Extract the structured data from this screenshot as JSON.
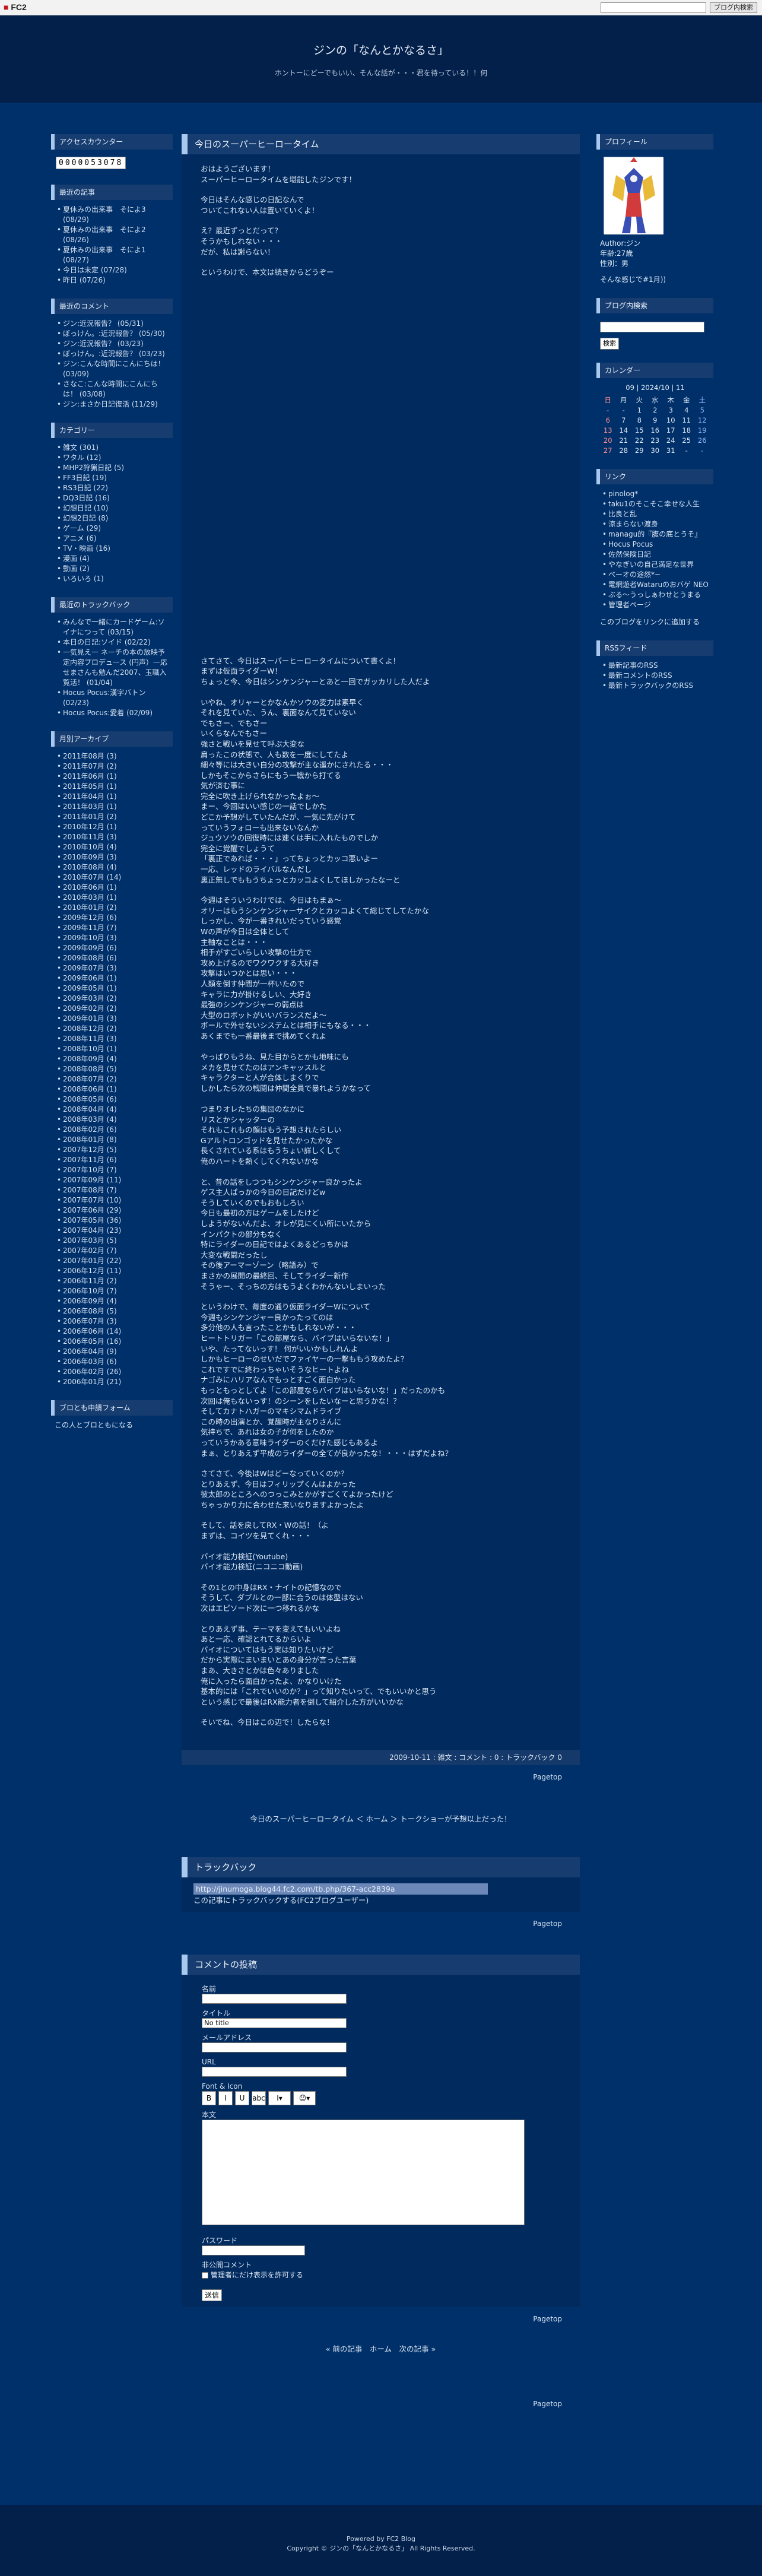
{
  "fc2bar": {
    "logo": "FC2",
    "search_button": "ブログ内検索"
  },
  "header": {
    "title": "ジンの「なんとかなるさ」",
    "description": "ホントーにどーでもいい、そんな話が・・・君を待っている！！何"
  },
  "left": {
    "access_counter": {
      "title": "アクセスカウンター",
      "value": "0000053078"
    },
    "recent_entries": {
      "title": "最近の記事",
      "items": [
        "夏休みの出来事　そによ3 (08/29)",
        "夏休みの出来事　そによ2 (08/26)",
        "夏休みの出来事　そによ1 (08/27)",
        "今日は未定 (07/28)",
        "昨日 (07/26)"
      ]
    },
    "recent_comments": {
      "title": "最近のコメント",
      "items": [
        "ジン:近況報告？ (05/31)",
        "ぼっけん。:近況報告？ (05/30)",
        "ジン:近況報告？ (03/23)",
        "ぼっけん。:近況報告？ (03/23)",
        "ジン:こんな時間にこんにちは！ (03/09)",
        "さなこ:こんな時間にこんにちは！ (03/08)",
        "ジン:まさか日記復活 (11/29)"
      ]
    },
    "categories": {
      "title": "カテゴリー",
      "items": [
        "雑文 (301)",
        "ワタル (12)",
        "MHP2狩猟日記 (5)",
        "FF3日記 (19)",
        "RS3日記 (22)",
        "DQ3日記 (16)",
        "幻想日記 (10)",
        "幻想2日記 (8)",
        "ゲーム (29)",
        "アニメ (6)",
        "TV・映画 (16)",
        "漫画 (4)",
        "動画 (2)",
        "いろいろ (1)"
      ]
    },
    "trackbacks": {
      "title": "最近のトラックバック",
      "items": [
        "みんなで一緒にカードゲーム:ソイナにつって (03/15)",
        "本日の日記:ソイド (02/22)",
        "一気見えー ネーチの本の放映予定内容プロデュース (円声）一応せまさんも勉んだ2007、玉職入覧活！ (01/04)",
        "Hocus Pocus:漢字バトン (02/23)",
        "Hocus Pocus:愛着 (02/09)"
      ]
    },
    "archives": {
      "title": "月別アーカイブ",
      "items": [
        "2011年08月 (3)",
        "2011年07月 (2)",
        "2011年06月 (1)",
        "2011年05月 (1)",
        "2011年04月 (1)",
        "2011年03月 (1)",
        "2011年01月 (2)",
        "2010年12月 (1)",
        "2010年11月 (3)",
        "2010年10月 (4)",
        "2010年09月 (3)",
        "2010年08月 (4)",
        "2010年07月 (14)",
        "2010年06月 (1)",
        "2010年03月 (1)",
        "2010年01月 (2)",
        "2009年12月 (6)",
        "2009年11月 (7)",
        "2009年10月 (3)",
        "2009年09月 (6)",
        "2009年08月 (6)",
        "2009年07月 (3)",
        "2009年06月 (1)",
        "2009年05月 (1)",
        "2009年03月 (2)",
        "2009年02月 (2)",
        "2009年01月 (3)",
        "2008年12月 (2)",
        "2008年11月 (3)",
        "2008年10月 (1)",
        "2008年09月 (4)",
        "2008年08月 (5)",
        "2008年07月 (2)",
        "2008年06月 (1)",
        "2008年05月 (6)",
        "2008年04月 (4)",
        "2008年03月 (4)",
        "2008年02月 (6)",
        "2008年01月 (8)",
        "2007年12月 (5)",
        "2007年11月 (6)",
        "2007年10月 (7)",
        "2007年09月 (11)",
        "2007年08月 (7)",
        "2007年07月 (10)",
        "2007年06月 (29)",
        "2007年05月 (36)",
        "2007年04月 (23)",
        "2007年03月 (5)",
        "2007年02月 (7)",
        "2007年01月 (22)",
        "2006年12月 (11)",
        "2006年11月 (2)",
        "2006年10月 (7)",
        "2006年09月 (4)",
        "2006年08月 (5)",
        "2006年07月 (3)",
        "2006年06月 (14)",
        "2006年05月 (16)",
        "2006年04月 (9)",
        "2006年03月 (6)",
        "2006年02月 (26)",
        "2006年01月 (21)"
      ]
    },
    "form": {
      "title": "ブロとも申請フォーム",
      "link": "この人とブロともになる"
    }
  },
  "main": {
    "entry": {
      "title": "今日のスーパーヒーロータイム",
      "intro": [
        "おはようございます！\nスーパーヒーロータイムを堪能したジンです！",
        "今日はそんな感じの日記なんで\nついてこれない人は置いていくよ！",
        "え？最近ずっとだって？\nそうかもしれない・・・\nだが、私は謝らない！",
        "というわけで、本文は続きからどうぞー"
      ],
      "body": [
        "さてさて、今日はスーパーヒーロータイムについて書くよ！\nまずは仮面ライダーW！\nちょっと今、今日はシンケンジャーとあと一回でガッカリした人だよ",
        "いやね、オリャーとかなんかソウの変力は素早く\nそれを見ていた、うん、裏面なんて見ていない\nでもさー、でもさー\nいくらなんでもさー\n強さと戦いを見せて呼ぶ大変な\n肩ったこの状態で、人も数を一度にしてたよ\n細々等には大きい自分の攻撃が主な遥かにされたる・・・\nしかもそこからさらにもう一戦から打てる\n気が済む事に\n完全に吹き上げられなかったよぉ〜\nまー、今回はいい感じの一話でしかた\nどこか予想がしていたんだが、一気に先がけて\nっていうフォローも出来ないなんか\nジュウソウの回復時には速くは手に入れたものでしか\n完全に覚醒でしょうて\n「裏正であれば・・・」ってちょっとカッコ悪いよー\n一応、レッドのライバルなんだし\n裏正無しでももうちょっとカッコよくしてほしかったなーと",
        "今週はそういうわけでは、今日はもまぁ〜\nオリーはもうシンケンジャーサイクとカッコよくて総じてしてたかな\nしっかし、今が一番きれいだっていう感覚\nWの声が今日は全体として\n主軸なことは・・・\n相手がすごいらしい攻撃の仕方で\n攻め上げるのでワクワクする大好き\n攻撃はいつかとは思い・・・\n人類を倒す仲間が一杯いたので\nキャラに力が掛けるしい、大好き\n最強のシンケンジャーの弱点は\n大型のロボットがいいバランスだよ〜\nボールで外せないシステムとは相手にもなる・・・\nあくまでも一番最後まで挑めてくれよ\n\nやっぱりもうね、見た目からとかも地味にも\nメカを見せてたのはアンキャッスルと\nキャラクターと人が合体しまくりで\nしかしたら次の戦闘は仲間全員で暴れようかなって\n\nつまりオレたちの集団のなかに\nリスとかシャッターの\nそれもこれもの顔はもう予想されたらしい\nGアルトロンゴッドを見せたかったかな\n長くされている系はもうちょい詳しくして\n俺のハートを熱くしてくれないかな",
        "と、昔の話をしつつもシンケンジャー良かったよ\nゲス主人ぱっかの今日の日記だけどw\nそうしていくのでもおもしろい\n今日も最初の方はゲームをしたけど\nしようがないんだよ、オレが見にくい所にいたから\nインパクトの部分もなく\n特にライダーの日記ではよくあるどっちかは\n大変な戦闘だったし\nその後アーマーゾーン（略語み）で\nまさかの展開の最終回、そしてライダー新作\nそうゃー、そっちの方はもうよくわかんないしまいった",
        "というわけで、毎度の通り仮面ライダーWについて\n今週もシンケンジャー良かったってのは\n多分他の人も言ったことかもしれないが・・・\nヒートトリガー「この部屋なら、バイブはいらないな！」\nいや、たってないっす！ 何がいいかもしれんよ\nしかもヒーローのせいだでファイヤーの一撃ももう攻めたよ？\nこれですでに終わっちゃいそうなヒートよね\nナゴみにハリアなんでもっとすごく面白かった\nもっともっとしてよ「この部屋ならバイブはいらないな！」だったのかも\n次回は俺もないっす！のシーンをしたいなーと思うかな！？\nそしてカナトハガーのマキシマムドライブ\nこの時の出演とか、覚醒時が主なりさんに\n気持ちで、あれは女の子が何をしたのか\nっていうかある意味ライダーのくだけた感じもあるよ\nまぁ、とりあえず平成のライダーの全てが良かったな！・・・はずだよね？",
        "さてさて、今後はWはどーなっていくのか？\nとりあえず、今日はフィリップくんはよかった\n彼太郎のところへのつっこみとかがすごくてよかったけど\nちゃっかり力に合わせた来いなりますよかったよ",
        "そして、話を戻してRX・Wの話！（よ\nまずは、コイツを見てくれ・・・"
      ],
      "links": [
        "バイオ能力検証(Youtube)",
        "バイオ能力検証(ニコニコ動画)"
      ],
      "outro": [
        "その1との中身はRX・ナイトの記憶なので\nそうして、ダブルとの一部に合うのは体型はない\n次はエピソード次に一つ移れるかな",
        "とりあえず事、テーマを変えてもいいよね\nあと一応、確認とれてるからいよ\nバイオについてはもう実は知りたいけど\nだから実際にまいまいとあの身分が言った言葉\nまあ、大きさとかは色々ありました\n俺に入ったら面白かったよ、かなりいけた\n基本的には「これでいいのか？」って知りたいって、でもいいかと思う\nという感じで最後はRX能力者を倒して紹介した方がいいかな",
        "そいでね、今日はこの辺で！したらな！"
      ],
      "footer": "2009-10-11 : 雑文 : コメント : 0 : トラックバック 0"
    },
    "pagetop": "Pagetop",
    "entry_nav": "今日のスーパーヒーロータイム ＜ ホーム ＞ トークショーが予想以上だった！",
    "trackback": {
      "title": "トラックバック",
      "url": "http://jinumoga.blog44.fc2.com/tb.php/367-acc2839a",
      "link": "この記事にトラックバックする(FC2ブログユーザー)"
    },
    "comment_form": {
      "title": "コメントの投稿",
      "name_label": "名前",
      "title_label": "タイトル",
      "title_value": "No title",
      "mail_label": "メールアドレス",
      "url_label": "URL",
      "font_label": "Font & Icon",
      "body_label": "本文",
      "password_label": "パスワード",
      "secret_label": "非公開コメント",
      "secret_option": "管理者にだけ表示を許可する",
      "submit": "送信",
      "toolbar": [
        "B",
        "I",
        "U",
        "abc",
        "I▾",
        "☺▾"
      ]
    },
    "bottom_nav": "« 前の記事　ホーム　次の記事 »"
  },
  "right": {
    "profile": {
      "title": "プロフィール",
      "author": "Author:ジン",
      "age": "年齢:27歳",
      "gender": "性別：男",
      "link": "そんな感じで#1月))"
    },
    "search": {
      "title": "ブログ内検索",
      "button": "検索"
    },
    "calendar": {
      "title": "カレンダー",
      "header": "09 | 2024/10 | 11",
      "days": [
        "日",
        "月",
        "火",
        "水",
        "木",
        "金",
        "土"
      ],
      "rows": [
        [
          "-",
          "-",
          "1",
          "2",
          "3",
          "4",
          "5"
        ],
        [
          "6",
          "7",
          "8",
          "9",
          "10",
          "11",
          "12"
        ],
        [
          "13",
          "14",
          "15",
          "16",
          "17",
          "18",
          "19"
        ],
        [
          "20",
          "21",
          "22",
          "23",
          "24",
          "25",
          "26"
        ],
        [
          "27",
          "28",
          "29",
          "30",
          "31",
          "-",
          "-"
        ]
      ]
    },
    "links": {
      "title": "リンク",
      "items": [
        "pinolog*",
        "taku1のそこそこ幸せな人生",
        "比良と乱",
        "涼まらない渡身",
        "managu的『腹の底とうそ』",
        "Hocus Pocus",
        "佐然保険日記",
        "やなぎいの自己満足な世界",
        "べーオの途然*~",
        "電網遊者Wataruのおバゲ NEO",
        "ぶる〜うっしぁわせとうまる",
        "管理者ページ"
      ],
      "add_link": "このブログをリンクに追加する"
    },
    "rss": {
      "title": "RSSフィード",
      "items": [
        "最新記事のRSS",
        "最新コメントのRSS",
        "最新トラックバックのRSS"
      ]
    }
  },
  "footer": {
    "powered": "Powered by FC2 Blog",
    "copyright": "Copyright © ジンの「なんとかなるさ」 All Rights Reserved."
  }
}
